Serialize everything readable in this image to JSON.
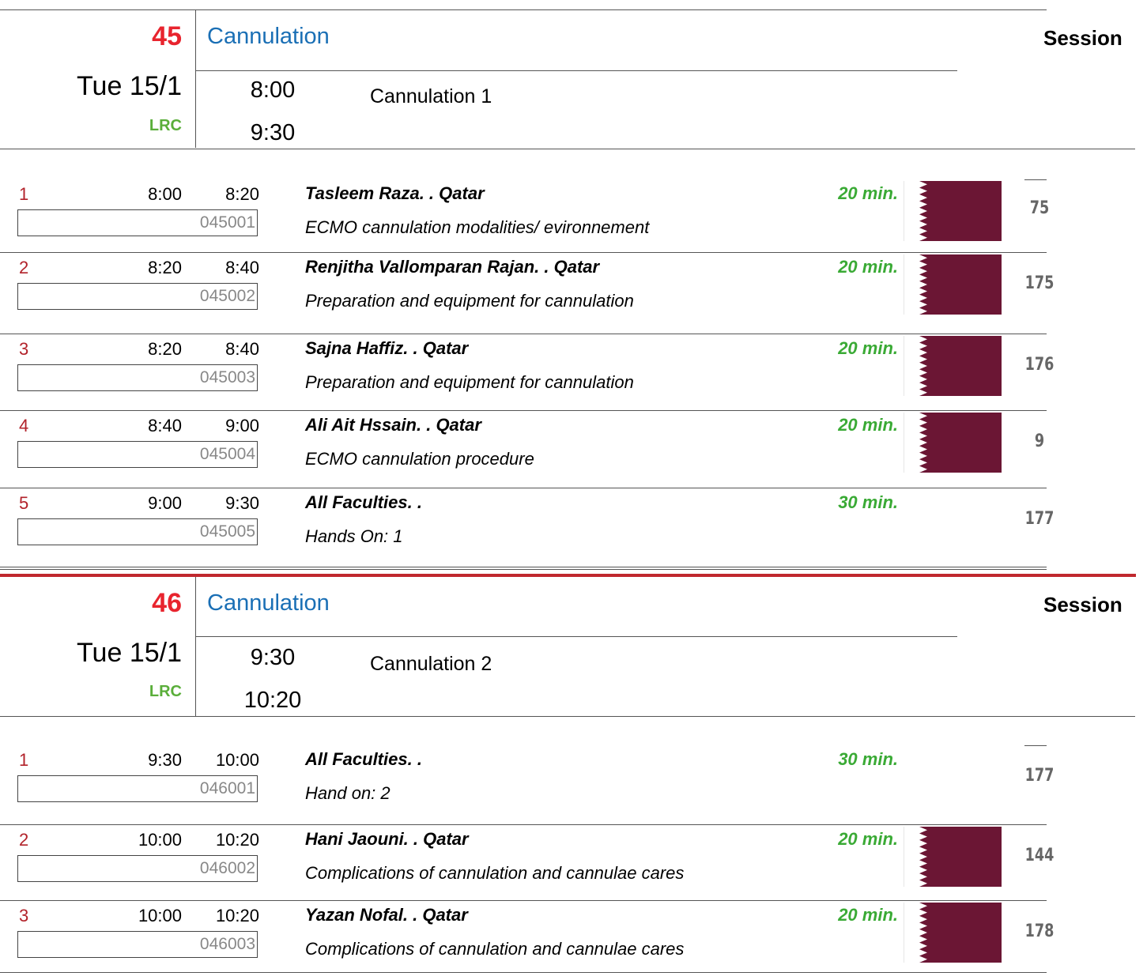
{
  "colors": {
    "session_number": "#e8242e",
    "session_title": "#1a6fb5",
    "room": "#5aae3a",
    "row_number": "#b2222a",
    "duration": "#3aaa35",
    "separator": "#c0282e",
    "flag_maroon": "#6b1634"
  },
  "sessions": [
    {
      "number": "45",
      "title": "Cannulation",
      "label": "Session",
      "date": "Tue 15/1",
      "room": "LRC",
      "start": "8:00",
      "end": "9:30",
      "subtitle": "Cannulation 1",
      "rows": [
        {
          "num": "1",
          "start": "8:00",
          "end": "8:20",
          "code": "045001",
          "speaker": "Tasleem Raza. . Qatar",
          "topic": "ECMO cannulation modalities/ evironnement",
          "duration": "20 min.",
          "id": "75",
          "flag": "qatar-flag-icon"
        },
        {
          "num": "2",
          "start": "8:20",
          "end": "8:40",
          "code": "045002",
          "speaker": "Renjitha Vallomparan Rajan. . Qatar",
          "topic": "Preparation and equipment for cannulation",
          "duration": "20 min.",
          "id": "175",
          "flag": "qatar-flag-icon"
        },
        {
          "num": "3",
          "start": "8:20",
          "end": "8:40",
          "code": "045003",
          "speaker": "Sajna Haffiz. . Qatar",
          "topic": "Preparation and equipment for cannulation",
          "duration": "20 min.",
          "id": "176",
          "flag": "qatar-flag-icon"
        },
        {
          "num": "4",
          "start": "8:40",
          "end": "9:00",
          "code": "045004",
          "speaker": "Ali Ait Hssain. . Qatar",
          "topic": "ECMO cannulation procedure",
          "duration": "20 min.",
          "id": "9",
          "flag": "qatar-flag-icon"
        },
        {
          "num": "5",
          "start": "9:00",
          "end": "9:30",
          "code": "045005",
          "speaker": "All Faculties. .",
          "topic": "Hands On: 1",
          "duration": "30 min.",
          "id": "177",
          "flag": ""
        }
      ]
    },
    {
      "number": "46",
      "title": "Cannulation",
      "label": "Session",
      "date": "Tue 15/1",
      "room": "LRC",
      "start": "9:30",
      "end": "10:20",
      "subtitle": "Cannulation 2",
      "rows": [
        {
          "num": "1",
          "start": "9:30",
          "end": "10:00",
          "code": "046001",
          "speaker": "All Faculties. .",
          "topic": "Hand on: 2",
          "duration": "30 min.",
          "id": "177",
          "flag": ""
        },
        {
          "num": "2",
          "start": "10:00",
          "end": "10:20",
          "code": "046002",
          "speaker": "Hani Jaouni. . Qatar",
          "topic": "Complications of cannulation and cannulae cares",
          "duration": "20 min.",
          "id": "144",
          "flag": "qatar-flag-icon"
        },
        {
          "num": "3",
          "start": "10:00",
          "end": "10:20",
          "code": "046003",
          "speaker": "Yazan Nofal. . Qatar",
          "topic": "Complications of cannulation and cannulae cares",
          "duration": "20 min.",
          "id": "178",
          "flag": "qatar-flag-icon"
        }
      ]
    }
  ]
}
